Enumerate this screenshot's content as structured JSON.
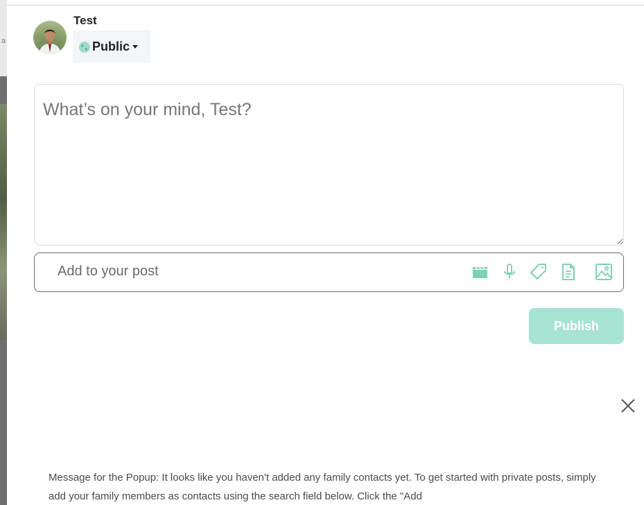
{
  "backdrop": {
    "stray_char": "a"
  },
  "user": {
    "name": "Test"
  },
  "privacy": {
    "label": "Public"
  },
  "composer": {
    "placeholder": "What’s on your mind, Test?"
  },
  "add_to_post": {
    "label": "Add to your post",
    "icons": [
      "video-icon",
      "microphone-icon",
      "tag-icon",
      "document-icon",
      "image-icon"
    ]
  },
  "publish": {
    "label": "Publish"
  },
  "popup": {
    "message": "Message for the Popup: It looks like you haven't added any family contacts yet. To get started with private posts, simply add your family members as contacts using the search field below. Click the \"Add"
  },
  "colors": {
    "accent": "#a7e3d2",
    "icon": "#7fcfb5"
  }
}
